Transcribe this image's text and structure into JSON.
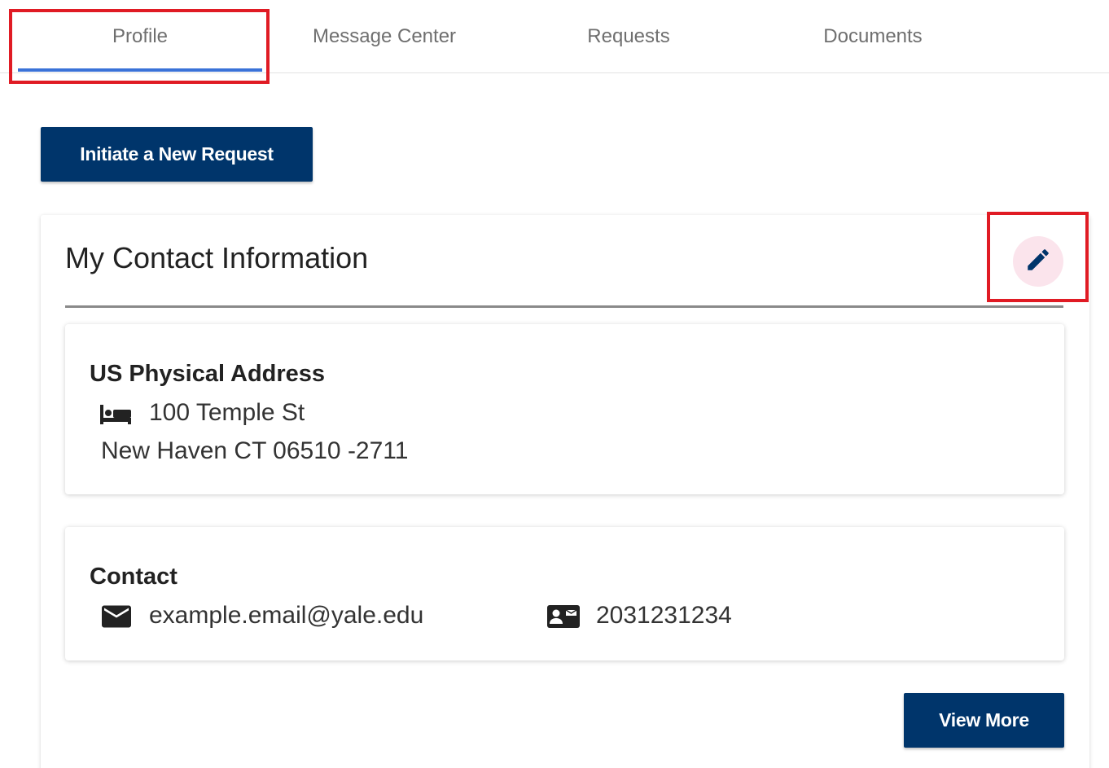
{
  "tabs": [
    {
      "label": "Profile",
      "active": true
    },
    {
      "label": "Message Center",
      "active": false
    },
    {
      "label": "Requests",
      "active": false
    },
    {
      "label": "Documents",
      "active": false
    }
  ],
  "actions": {
    "initiate_label": "Initiate a New Request",
    "view_more_label": "View More"
  },
  "contact_info": {
    "title": "My Contact Information",
    "edit_icon": "pencil-icon",
    "address": {
      "heading": "US Physical Address",
      "icon": "bed-icon",
      "street": "100 Temple St",
      "city_line": "New Haven CT 06510 -2711"
    },
    "contact": {
      "heading": "Contact",
      "email_icon": "mail-icon",
      "email": "example.email@yale.edu",
      "phone_icon": "contact-card-icon",
      "phone": "2031231234"
    }
  },
  "colors": {
    "primary": "#00356b",
    "tab_active_underline": "#3a72d8",
    "highlight": "#e01b24",
    "edit_bg": "#fbe4ec"
  }
}
